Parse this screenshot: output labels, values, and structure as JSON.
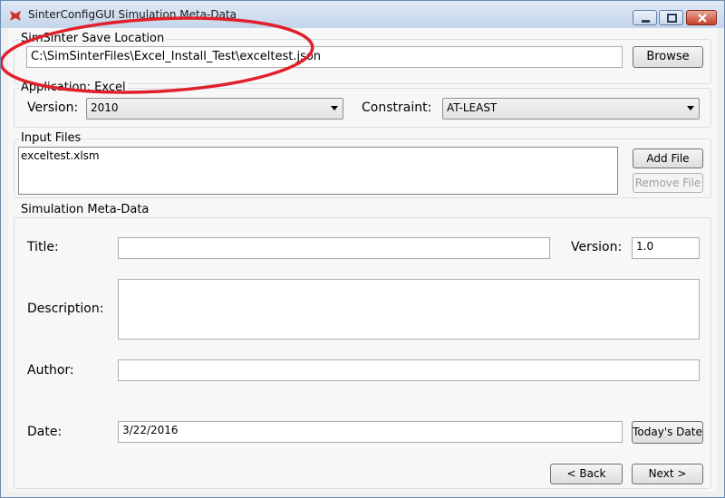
{
  "window": {
    "title": "SinterConfigGUI Simulation Meta-Data",
    "app_icon": "sinter-logo-icon"
  },
  "save_location": {
    "group_label": "SimSinter Save Location",
    "path_value": "C:\\SimSinterFiles\\Excel_Install_Test\\exceltest.json",
    "browse_label": "Browse"
  },
  "application": {
    "group_label": "Application: Excel",
    "version_label": "Version:",
    "version_value": "2010",
    "constraint_label": "Constraint:",
    "constraint_value": "AT-LEAST"
  },
  "input_files": {
    "group_label": "Input Files",
    "files": [
      "exceltest.xlsm"
    ],
    "add_label": "Add File",
    "remove_label": "Remove File"
  },
  "meta": {
    "group_label": "Simulation Meta-Data",
    "title_label": "Title:",
    "title_value": "",
    "version_label": "Version:",
    "version_value": "1.0",
    "description_label": "Description:",
    "description_value": "",
    "author_label": "Author:",
    "author_value": "",
    "date_label": "Date:",
    "date_value": "3/22/2016",
    "today_label": "Today's Date"
  },
  "nav": {
    "back_label": "< Back",
    "next_label": "Next >"
  },
  "colors": {
    "annotation_circle": "#e0202a"
  }
}
